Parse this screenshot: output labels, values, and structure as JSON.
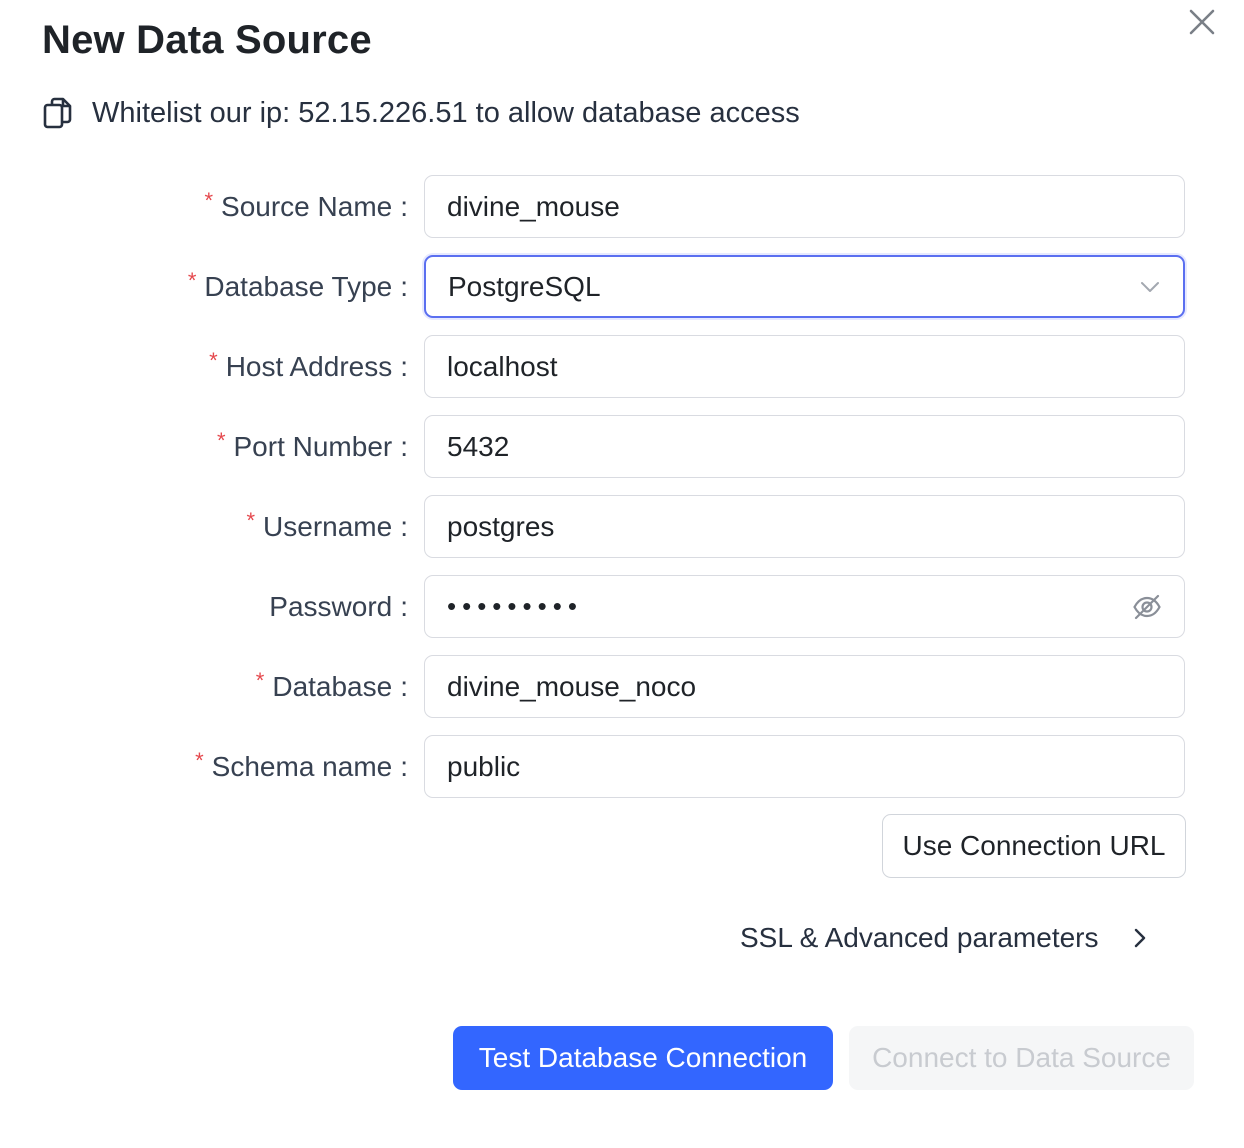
{
  "dialog": {
    "title": "New Data Source",
    "whitelist_text": "Whitelist our ip: 52.15.226.51 to allow database access"
  },
  "form": {
    "fields": [
      {
        "label": "Source Name",
        "required": true,
        "value": "divine_mouse"
      },
      {
        "label": "Database Type",
        "required": true,
        "value": "PostgreSQL"
      },
      {
        "label": "Host Address",
        "required": true,
        "value": "localhost"
      },
      {
        "label": "Port Number",
        "required": true,
        "value": "5432"
      },
      {
        "label": "Username",
        "required": true,
        "value": "postgres"
      },
      {
        "label": "Password",
        "required": false,
        "value": "•••••••••"
      },
      {
        "label": "Database",
        "required": true,
        "value": "divine_mouse_noco"
      },
      {
        "label": "Schema name",
        "required": true,
        "value": "public"
      }
    ],
    "required_mark": "*",
    "colon": ":"
  },
  "actions": {
    "use_url_label": "Use Connection URL",
    "ssl_label": "SSL & Advanced parameters",
    "test_label": "Test Database Connection",
    "connect_label": "Connect to Data Source"
  },
  "colors": {
    "primary": "#3366ff",
    "focus_border": "#5b6ff0",
    "required": "#e5484d",
    "disabled_text": "#c8cbd0"
  },
  "icons": {
    "close": "close-icon",
    "copy": "copy-icon",
    "select": "chevron-down-icon",
    "password_toggle": "eye-off-icon",
    "ssl": "chevron-right-icon"
  }
}
